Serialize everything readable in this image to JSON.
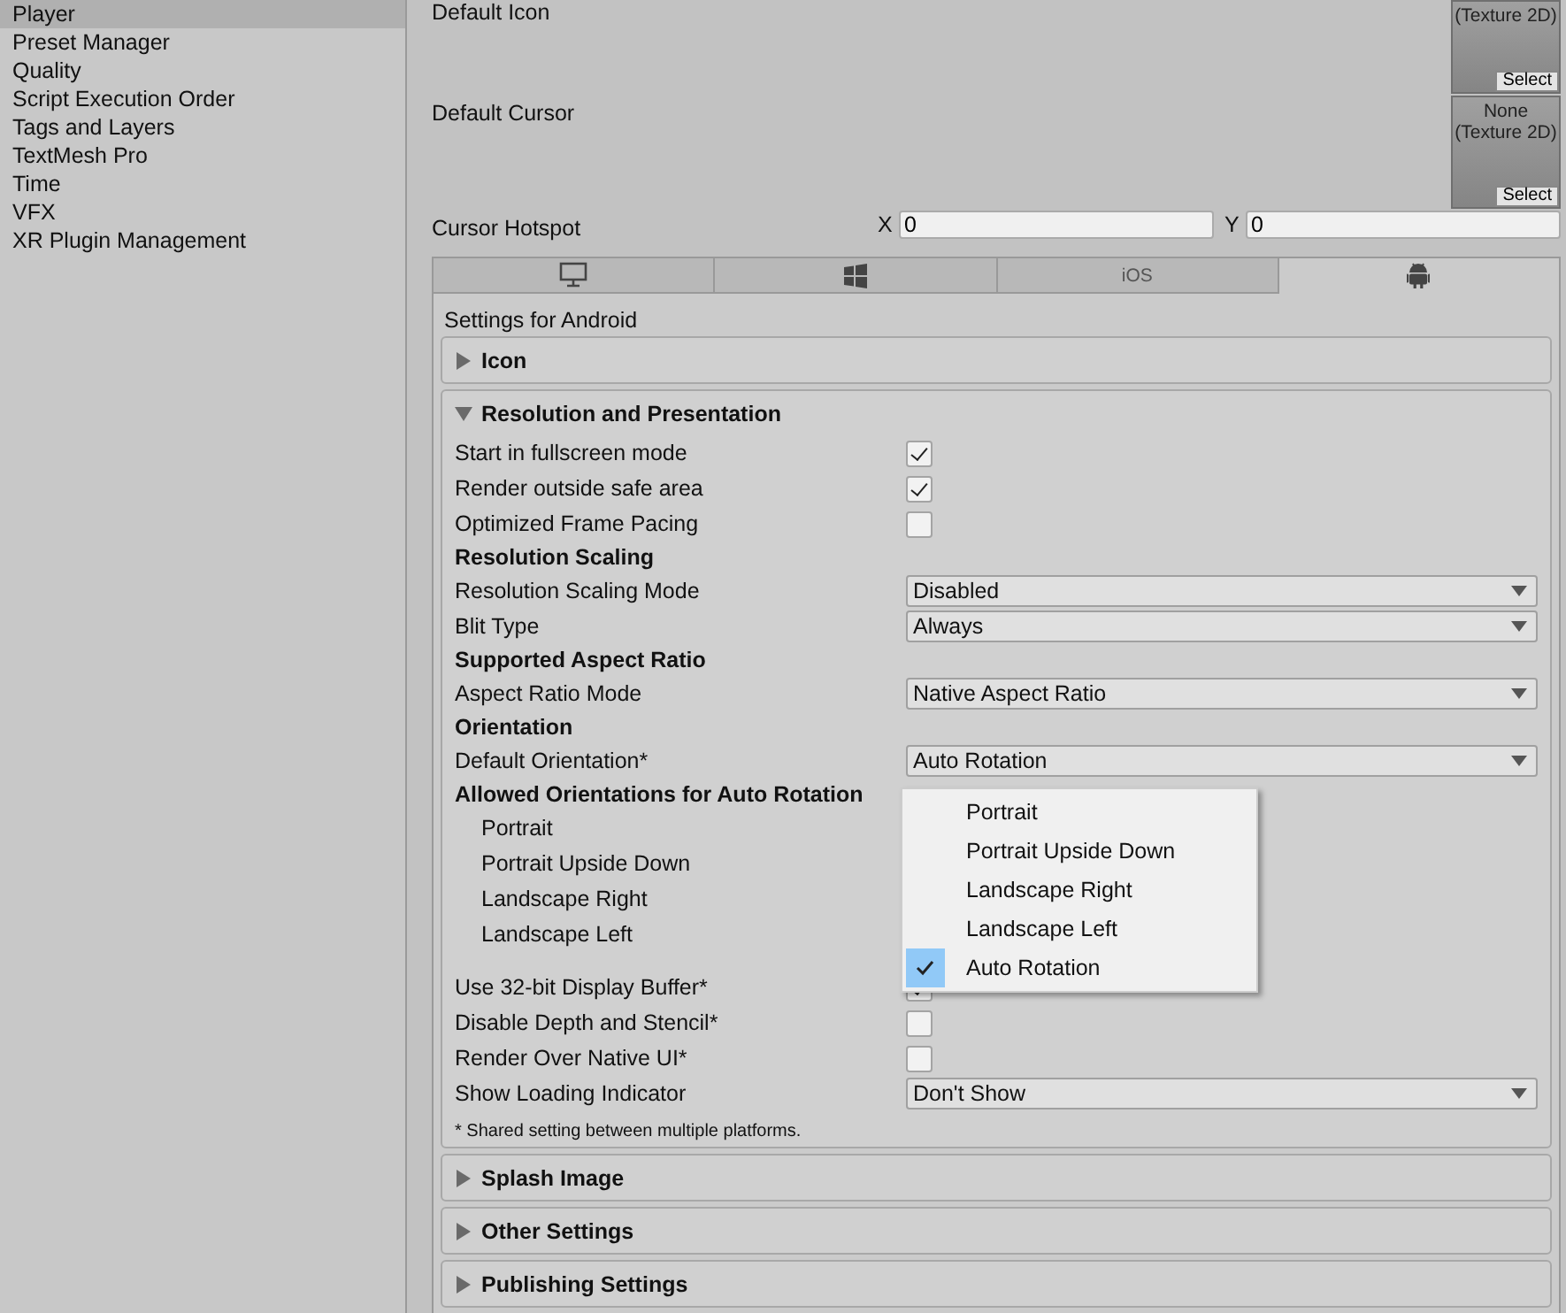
{
  "sidebar": {
    "items": [
      {
        "label": "Player",
        "selected": true
      },
      {
        "label": "Preset Manager",
        "selected": false
      },
      {
        "label": "Quality",
        "selected": false
      },
      {
        "label": "Script Execution Order",
        "selected": false
      },
      {
        "label": "Tags and Layers",
        "selected": false
      },
      {
        "label": "TextMesh Pro",
        "selected": false
      },
      {
        "label": "Time",
        "selected": false
      },
      {
        "label": "VFX",
        "selected": false
      },
      {
        "label": "XR Plugin Management",
        "selected": false
      }
    ]
  },
  "top_fields": [
    {
      "kind": "texture",
      "label": "Default Icon",
      "thumbnail_lines": [
        "(Texture 2D)"
      ],
      "button": "Select"
    },
    {
      "kind": "texture",
      "label": "Default Cursor",
      "thumbnail_lines": [
        "None",
        "(Texture 2D)"
      ],
      "button": "Select"
    },
    {
      "kind": "vector2",
      "label": "Cursor Hotspot",
      "x_label": "X",
      "x_value": "0",
      "y_label": "Y",
      "y_value": "0"
    }
  ],
  "platform_tabs": [
    {
      "kind": "monitor",
      "selected": false
    },
    {
      "kind": "windows",
      "selected": false
    },
    {
      "kind": "text",
      "label": "iOS",
      "selected": false
    },
    {
      "kind": "android",
      "selected": true
    }
  ],
  "settings_title": "Settings for Android",
  "sections": [
    {
      "title": "Icon",
      "expanded": false
    },
    {
      "title": "Resolution and Presentation",
      "expanded": true,
      "rows": [
        {
          "kind": "checkbox",
          "label": "Start in fullscreen mode",
          "checked": true
        },
        {
          "kind": "checkbox",
          "label": "Render outside safe area",
          "checked": true
        },
        {
          "kind": "checkbox",
          "label": "Optimized Frame Pacing",
          "checked": false
        },
        {
          "kind": "heading",
          "label": "Resolution Scaling"
        },
        {
          "kind": "dropdown",
          "label": "Resolution Scaling Mode",
          "value": "Disabled"
        },
        {
          "kind": "dropdown",
          "label": "Blit Type",
          "value": "Always"
        },
        {
          "kind": "heading",
          "label": "Supported Aspect Ratio"
        },
        {
          "kind": "dropdown",
          "label": "Aspect Ratio Mode",
          "value": "Native Aspect Ratio"
        },
        {
          "kind": "heading",
          "label": "Orientation"
        },
        {
          "kind": "dropdown",
          "label": "Default Orientation*",
          "value": "Auto Rotation"
        },
        {
          "kind": "heading",
          "label": "Allowed Orientations for Auto Rotation"
        },
        {
          "kind": "sublabel",
          "label": "Portrait"
        },
        {
          "kind": "sublabel",
          "label": "Portrait Upside Down"
        },
        {
          "kind": "sublabel",
          "label": "Landscape Right"
        },
        {
          "kind": "sublabel",
          "label": "Landscape Left"
        },
        {
          "kind": "spacer"
        },
        {
          "kind": "checkbox",
          "label": "Use 32-bit Display Buffer*",
          "checked": true
        },
        {
          "kind": "checkbox",
          "label": "Disable Depth and Stencil*",
          "checked": false
        },
        {
          "kind": "checkbox",
          "label": "Render Over Native UI*",
          "checked": false
        },
        {
          "kind": "dropdown",
          "label": "Show Loading Indicator",
          "value": "Don't Show"
        }
      ],
      "footnote": "* Shared setting between multiple platforms."
    },
    {
      "title": "Splash Image",
      "expanded": false
    },
    {
      "title": "Other Settings",
      "expanded": false
    },
    {
      "title": "Publishing Settings",
      "expanded": false
    }
  ],
  "dropdown_menu": {
    "items": [
      {
        "label": "Portrait",
        "selected": false
      },
      {
        "label": "Portrait Upside Down",
        "selected": false
      },
      {
        "label": "Landscape Right",
        "selected": false
      },
      {
        "label": "Landscape Left",
        "selected": false
      },
      {
        "label": "Auto Rotation",
        "selected": true
      }
    ]
  }
}
